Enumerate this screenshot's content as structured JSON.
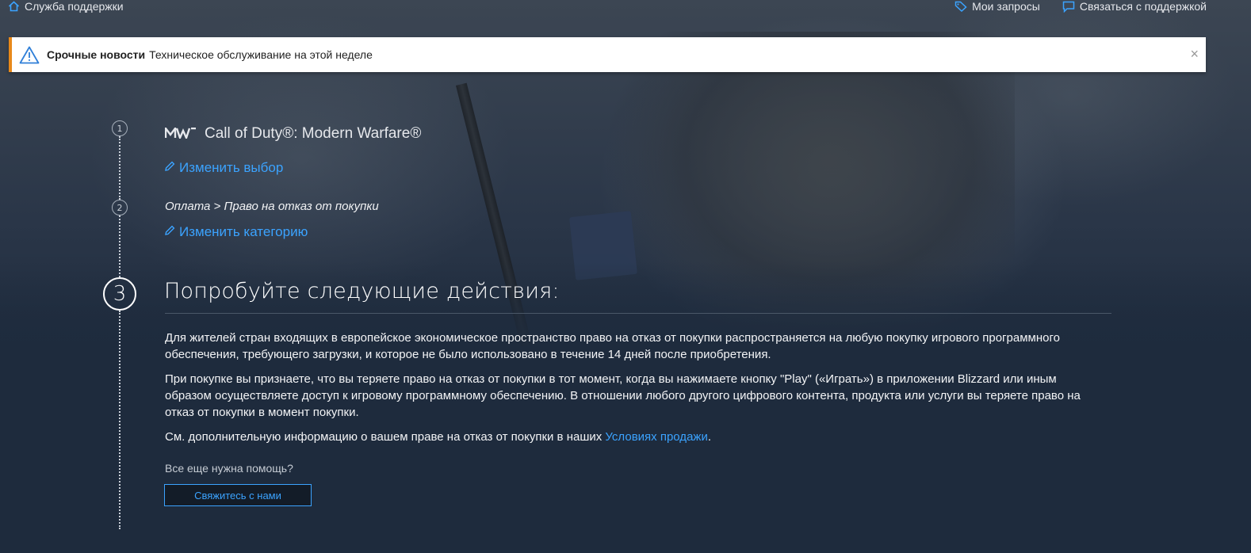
{
  "topbar": {
    "home_label": "Служба поддержки",
    "my_requests_label": "Мои запросы",
    "contact_support_label": "Связаться с поддержкой"
  },
  "alert": {
    "title": "Срочные новости",
    "message": "Техническое обслуживание на этой неделе",
    "close": "×"
  },
  "steps": {
    "step1": {
      "number": "1",
      "game_logo": "MW",
      "game_title": "Call of Duty®: Modern Warfare®",
      "edit_label": "Изменить выбор"
    },
    "step2": {
      "number": "2",
      "breadcrumb": "Оплата > Право на отказ от покупки",
      "edit_label": "Изменить категорию"
    },
    "step3": {
      "number": "3",
      "heading": "Попробуйте следующие действия:",
      "paragraph1": "Для жителей стран входящих в европейское экономическое пространство право на отказ от покупки распространяется на любую покупку игрового программного обеспечения, требующего загрузки, и которое не было использовано в течение 14 дней после приобретения.",
      "paragraph2": "При покупке вы признаете, что вы теряете право на отказ от покупки в тот момент, когда вы нажимаете кнопку \"Play\" («Играть») в приложении Blizzard или иным образом осуществляете доступ к игровому программному обеспечению. В отношении любого другого цифрового контента, продукта или услуги вы теряете право на отказ от покупки в момент покупки.",
      "paragraph3_prefix": "См. дополнительную информацию о вашем праве на отказ от покупки в наших ",
      "paragraph3_link": "Условиях продажи",
      "paragraph3_suffix": ".",
      "help_text": "Все еще нужна помощь?",
      "contact_button": "Свяжитесь с нами"
    }
  },
  "colors": {
    "accent": "#3ba3ff",
    "alert_border": "#e8891a",
    "background": "#1e2b3d"
  }
}
